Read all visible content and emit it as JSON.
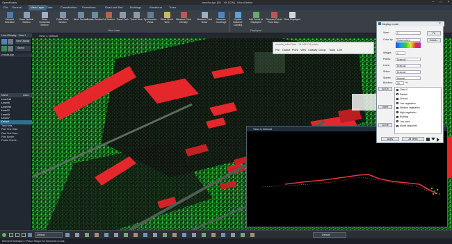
{
  "window": {
    "app_name": "OpenRoads",
    "title": "zmedia.dgn [2D - V8 DGN] - MicroStation"
  },
  "tabs": [
    "File",
    "General",
    "View Layer",
    "Data",
    "Classification",
    "Powerlines",
    "Road and Rail",
    "Buildings",
    "Waveform",
    "Trees"
  ],
  "active_tab": 2,
  "ribbon": {
    "buttons": [
      "Element Selection",
      "Draw Vertical Section",
      "Draw Horizontal Section",
      "Draw Plane Section",
      "Move Section",
      "Rotate Section",
      "Cut Section",
      "Travel Path",
      "Travel View",
      "Synchronize Views",
      "Show Street View",
      "Measure Point Density",
      "Measure Point Noise",
      "Measure Coverage",
      "Update Distance Coloring",
      "Add Points to Displayed",
      "Remove Points From Disp...",
      "Clear Displayed"
    ],
    "groups": [
      "View Laser",
      "Displayed"
    ]
  },
  "left_panel": {
    "title": "Level Display - View 1",
    "search_placeholder": "View Display",
    "search_label": "Saved",
    "file_item": "zmedia.dgn",
    "columns": [
      "Name",
      "Used"
    ],
    "levels": [
      "Level 49",
      "Level 6",
      "Level 50",
      "Level 2",
      "Level 5",
      "Level 7",
      "Default",
      "Text Hints",
      "Plan Text Hints",
      "Plan Text Desc...",
      "Plan Border",
      "Profile Grid M..."
    ],
    "selected_level": 6
  },
  "view1": {
    "title": "View 1, Default"
  },
  "floating_toolbar": {
    "title": "zmedia_colorClass - 34 169 711 points",
    "menus": [
      "File",
      "Output",
      "Point",
      "View",
      "Classify",
      "Group",
      "Tools",
      "Line"
    ]
  },
  "display_dialog": {
    "title": "Display mode",
    "fields": [
      {
        "label": "View:",
        "value": "1"
      },
      {
        "label": "Color by:",
        "value": "Class colors"
      },
      {
        "label": "Weight:",
        "value": "1"
      },
      {
        "label": "Points:",
        "value": "Draw all"
      },
      {
        "label": "Lines:",
        "value": "Draw all"
      },
      {
        "label": "Shine:",
        "value": "Draw all"
      },
      {
        "label": "Speed:",
        "value": "Normal"
      }
    ],
    "fit_button": "Fit",
    "colors_button": "Colors...",
    "border_label": "Borders:",
    "border_value": "10",
    "border_unit": "%",
    "side_buttons": [
      "All On",
      "Invert",
      "All Off"
    ],
    "classes": [
      "Class 0",
      "Default",
      "Ground",
      "Low vegetation",
      "Medium vegetation",
      "High vegetation",
      "Building",
      "Low point",
      "Model keypoints"
    ],
    "class_colors": [
      "#9a9a9a",
      "#d0d0d0",
      "#a05a2c",
      "#5fae3f",
      "#39c242",
      "#1d8f24",
      "#e03a3a",
      "#ff00ff",
      "#f0e000"
    ],
    "apply_button": "Apply",
    "all_views_button": "All views"
  },
  "view3": {
    "title": "View 3, Default"
  },
  "bottom_toolbar": {
    "default_label": "Default",
    "level_label": "Default"
  },
  "status": {
    "text": "Element Selection > Place Shape for elements to ask"
  }
}
